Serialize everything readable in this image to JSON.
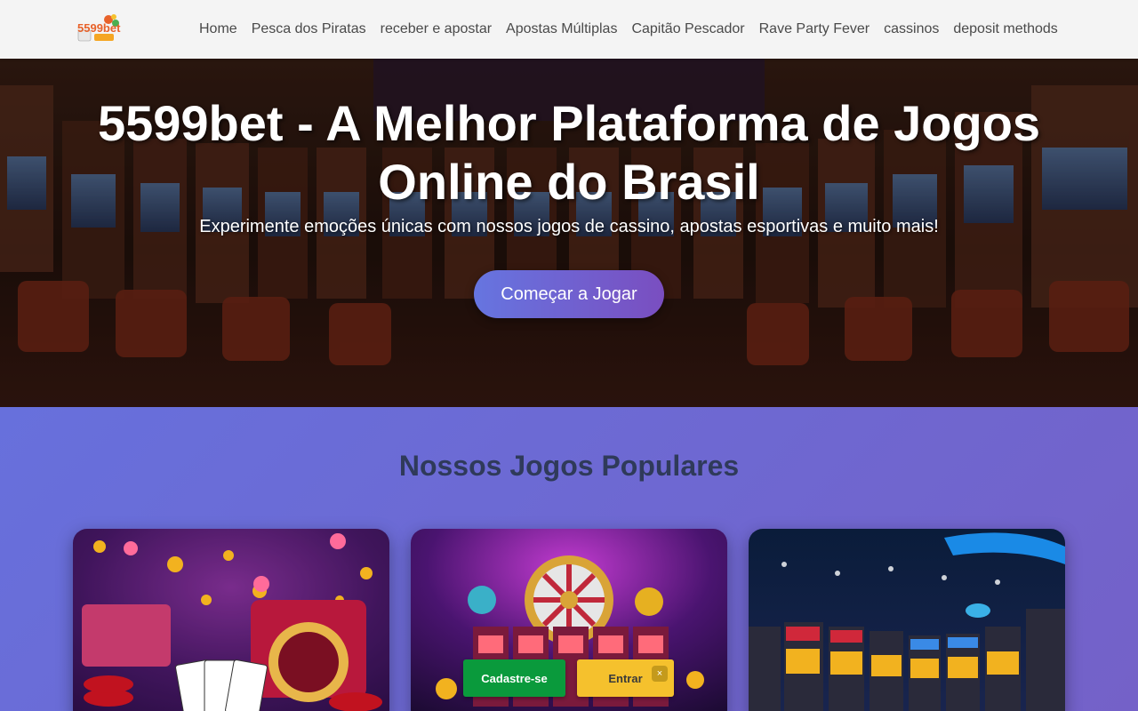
{
  "header": {
    "logo_text": "5599bet",
    "nav": [
      "Home",
      "Pesca dos Piratas",
      "receber e apostar",
      "Apostas Múltiplas",
      "Capitão Pescador",
      "Rave Party Fever",
      "cassinos",
      "deposit methods"
    ]
  },
  "hero": {
    "title_line1": "5599bet - A Melhor Plataforma de Jogos",
    "title_line2": "Online do Brasil",
    "subtitle": "Experimente emoções únicas com nossos jogos de cassino, apostas esportivas e muito mais!",
    "cta_label": "Começar a Jogar"
  },
  "games": {
    "title": "Nossos Jogos Populares"
  },
  "floating_bar": {
    "signup_label": "Cadastre-se",
    "login_label": "Entrar",
    "close_icon": "×"
  },
  "colors": {
    "accent_gradient_start": "#6675e0",
    "accent_gradient_end": "#7a4ec0",
    "signup_green": "#0a9a3c",
    "login_yellow": "#f5c12d",
    "section_bg": "#6a6fd8"
  }
}
